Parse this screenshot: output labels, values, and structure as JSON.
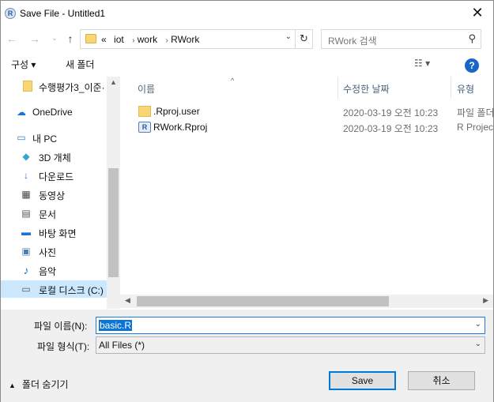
{
  "window": {
    "app_icon": "R",
    "title": "Save File - Untitled1",
    "close_glyph": "✕"
  },
  "nav": {
    "back_glyph": "←",
    "forward_glyph": "→",
    "recent_glyph": "⌄",
    "up_glyph": "↑"
  },
  "address": {
    "crumbs": [
      "«",
      "iot",
      "work",
      "RWork"
    ],
    "sep": "›",
    "dropdown": "⌄",
    "refresh": "↻"
  },
  "search": {
    "placeholder": "RWork 검색",
    "icon_glyph": "⚲"
  },
  "toolbar": {
    "organize_label": "구성 ▾",
    "new_folder_label": "새 폴더",
    "view_label": "☷ ▾",
    "help_label": "?"
  },
  "sidebar": {
    "items": [
      {
        "label": "수행평가3_이준·",
        "icon": "folder-icon",
        "glyph": "▮"
      },
      {
        "label": "OneDrive",
        "icon": "cloud-icon",
        "glyph": "☁"
      },
      {
        "label": "내 PC",
        "icon": "pc-icon",
        "glyph": "▭"
      },
      {
        "label": "3D 개체",
        "icon": "cube-icon",
        "glyph": "◆"
      },
      {
        "label": "다운로드",
        "icon": "download-icon",
        "glyph": "↓"
      },
      {
        "label": "동영상",
        "icon": "video-icon",
        "glyph": "▦"
      },
      {
        "label": "문서",
        "icon": "document-icon",
        "glyph": "▤"
      },
      {
        "label": "바탕 화면",
        "icon": "desktop-icon",
        "glyph": "▬"
      },
      {
        "label": "사진",
        "icon": "picture-icon",
        "glyph": "▣"
      },
      {
        "label": "음악",
        "icon": "music-icon",
        "glyph": "♪"
      },
      {
        "label": "로컬 디스크 (C:)",
        "icon": "disk-icon",
        "glyph": "▭"
      }
    ],
    "scroll_up": "▲",
    "scroll_down": "▼"
  },
  "columns": {
    "name": "이름",
    "modified": "수정한 날짜",
    "type": "유형",
    "sort_caret": "^"
  },
  "files": [
    {
      "name": ".Rproj.user",
      "date": "2020-03-19 오전 10:23",
      "type": "파일 폴더",
      "icon": "folder-icon"
    },
    {
      "name": "RWork.Rproj",
      "date": "2020-03-19 오전 10:23",
      "type": "R Project",
      "icon": "rproj-file-icon"
    }
  ],
  "hscroll": {
    "left": "◀",
    "right": "▶"
  },
  "form": {
    "filename_label": "파일 이름(N):",
    "filename_value": "basic.R",
    "filetype_label": "파일 형식(T):",
    "filetype_value": "All Files  (*)",
    "dropdown": "⌄"
  },
  "footer": {
    "hide_folders_caret": "▲",
    "hide_folders_label": "폴더 숨기기",
    "save_label": "Save",
    "cancel_label": "취소"
  },
  "colors": {
    "accent": "#0078d7",
    "selection": "#cce8ff",
    "folder": "#f7d673"
  }
}
